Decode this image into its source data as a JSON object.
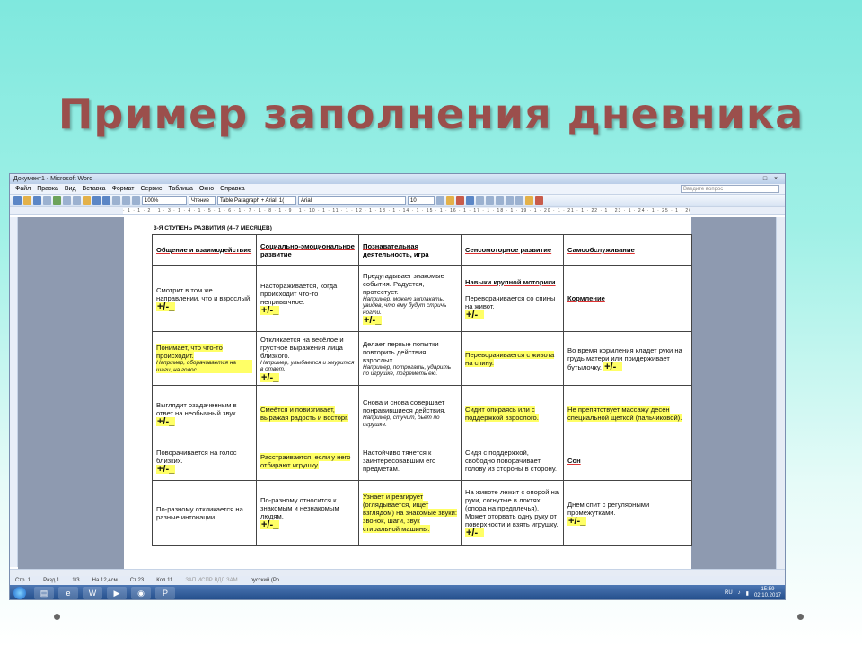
{
  "slide": {
    "title": "Пример заполнения дневника"
  },
  "window": {
    "title": "Документ1 - Microsoft Word",
    "menu": [
      "Файл",
      "Правка",
      "Вид",
      "Вставка",
      "Формат",
      "Сервис",
      "Таблица",
      "Окно",
      "Справка"
    ],
    "ask_placeholder": "Введите вопрос",
    "zoom": "100%",
    "read_button": "Чтение",
    "style": "Table Paragraph + Arial, 1(",
    "font": "Arial",
    "font_size": "10",
    "ruler": "· 1 · 1 · 2 · 1 · 3 · 1 · 4 · 1 · 5 · 1 · 6 · 1 · 7 · 1 · 8 · 1 · 9 · 1 · 10 · 1 · 11 · 1 · 12 · 1 · 13 · 1 · 14 · 1 · 15 · 1 · 16 · 1 · 17 · 1 · 18 · 1 · 19 · 1 · 20 · 1 · 21 · 1 · 22 · 1 · 23 · 1 · 24 · 1 · 25 · 1 · 26 · 1 · 27 · 1 · 28"
  },
  "status": {
    "page": "Стр. 1",
    "section": "Разд 1",
    "pages": "1/3",
    "pos": "На 12,4см",
    "line": "Ст 23",
    "col": "Кол 11",
    "modes": "ЗАП  ИСПР  ВДЛ  ЗАМ",
    "lang": "русский (Ро"
  },
  "taskbar": {
    "lang": "RU",
    "time": "15:59",
    "date": "02.10.2017"
  },
  "doc": {
    "heading": "3-Я СТУПЕНЬ РАЗВИТИЯ (4–7 МЕСЯЦЕВ)",
    "columns": [
      "Общение и взаимодействие",
      "Социально-эмоциональное развитие",
      "Познавательная деятельность, игра",
      "Сенсомоторное развитие",
      "Самообслуживание"
    ],
    "pm": "+/-_",
    "r1": {
      "c1": "Смотрит в том же направлении, что и взрослый.",
      "c2": "Настораживается, когда происходит что-то непривычное.",
      "c3": "Предугадывает знакомые события. Радуется, протестует.",
      "c3ex": "Например, может заплакать, увидев, что ему будут стричь ногти.",
      "c4head": "Навыки крупной моторики",
      "c4": "Переворачивается со спины на живот.",
      "c5": "Кормление"
    },
    "r2": {
      "c1": "Понимает, что что-то происходит.",
      "c1ex": "Например, оборачивается на шаги, на голос.",
      "c2": "Откликается на весёлое и грустное выражения лица близкого.",
      "c2ex": "Например, улыбается и хмурится в ответ.",
      "c3": "Делает первые попытки повторить действия взрослых.",
      "c3ex": "Например, потрогать, ударить по игрушке, погреметь ею.",
      "c4": "Переворачивается с живота на спину.",
      "c5": "Во время кормления кладет руки на грудь матери или придерживает бутылочку."
    },
    "r3": {
      "c1": "Выглядит озадаченным в ответ на необычный звук.",
      "c2": "Смеётся и повизгивает, выражая радость и восторг.",
      "c3": "Снова и снова совершает понравившиеся действия.",
      "c3ex": "Например, стучит, бьет по игрушке.",
      "c4": "Сидит опираясь или с поддержкой взрослого.",
      "c5": "Не препятствует массажу десен специальной щеткой (пальчиковой)."
    },
    "r4": {
      "c1": "Поворачивается на голос близких.",
      "c2": "Расстраивается, если у него отбирают игрушку.",
      "c3": "Настойчиво тянется к заинтересовавшим его предметам.",
      "c4": "Сидя с поддержкой, свободно поворачивает голову из стороны в сторону.",
      "c5": "Сон"
    },
    "r5": {
      "c1": "По-разному откликается на разные интонации.",
      "c2": "По-разному относится к знакомым и незнакомым людям.",
      "c3": "Узнает и реагирует (оглядывается, ищет взглядом) на знакомые звуки: звонок, шаги, звук стиральной машины.",
      "c4": "На животе лежит с опорой на руки, согнутые в локтях (опора на предплечья). Может оторвать одну руку от поверхности и взять игрушку.",
      "c5": "Днем спит с регулярными промежутками."
    }
  }
}
